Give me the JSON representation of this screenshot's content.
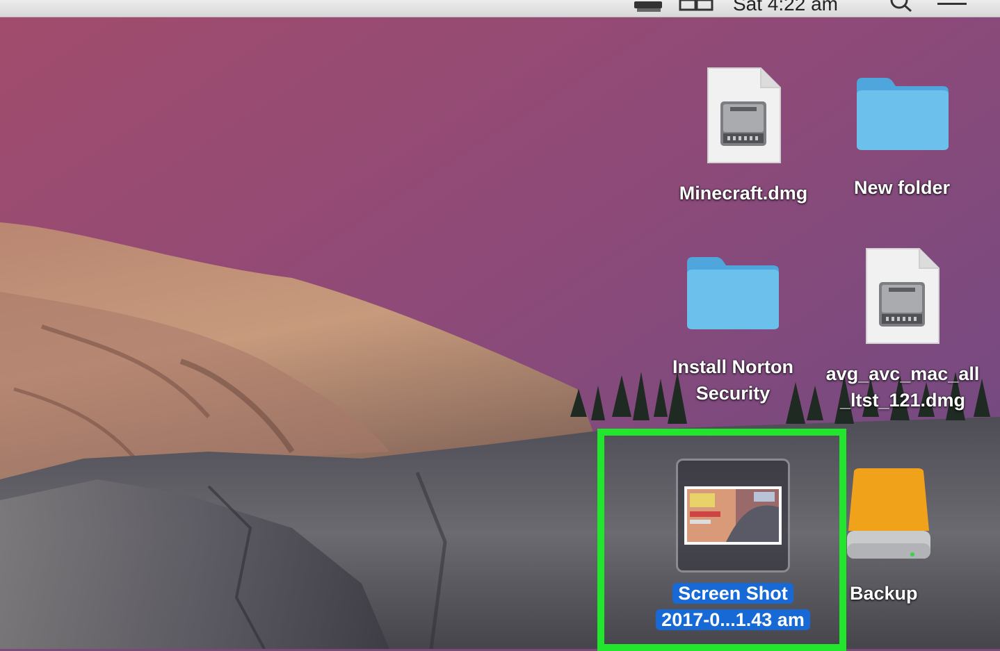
{
  "menubar": {
    "clock": "Sat 4:22 am",
    "icons": [
      "drive-icon",
      "display-icon",
      "spotlight-search-icon",
      "notification-center-icon"
    ]
  },
  "desktop": {
    "icons": [
      {
        "name": "Minecraft.dmg",
        "kind": "disk-image-file-icon"
      },
      {
        "name": "New folder",
        "kind": "folder-icon"
      },
      {
        "name_line1": "Install Norton",
        "name_line2": "Security",
        "kind": "folder-icon"
      },
      {
        "name_line1": "avg_avc_mac_all",
        "name_line2": "_ltst_121.dmg",
        "kind": "disk-image-file-icon"
      },
      {
        "name_line1": "Screen Shot",
        "name_line2": "2017-0...1.43 am",
        "kind": "screenshot-thumbnail-icon",
        "selected": true,
        "highlighted": true
      },
      {
        "name": "Backup",
        "kind": "external-drive-icon"
      }
    ]
  },
  "colors": {
    "highlight": "#22e52e",
    "selection": "#1769d6",
    "folder": "#5ab4e6",
    "drive": "#f0a21a",
    "sky": "#8a4a78"
  }
}
